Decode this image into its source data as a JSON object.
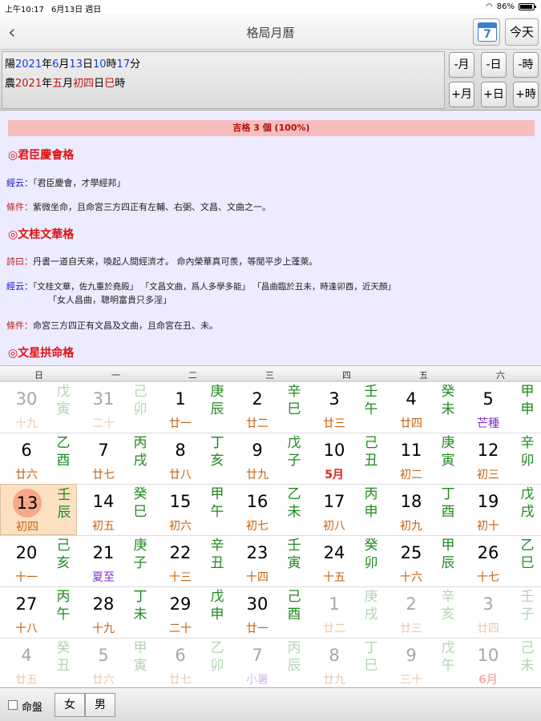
{
  "status": {
    "time": "上午10:17",
    "date": "6月13日 週日",
    "battery": "86%"
  },
  "nav": {
    "title": "格局月曆",
    "calendar_day": "7",
    "today_label": "今天"
  },
  "info": {
    "solar": [
      "陽",
      "2021",
      "年",
      "6",
      "月",
      "13",
      "日",
      "10",
      "時",
      "17",
      "分"
    ],
    "lunar": [
      "農",
      "2021",
      "年",
      "五",
      "月",
      "初四",
      "日",
      "巳",
      "時"
    ],
    "buttons": {
      "minus_month": "-月",
      "minus_day": "-日",
      "minus_hour": "-時",
      "plus_month": "+月",
      "plus_day": "+日",
      "plus_hour": "+時"
    }
  },
  "content": {
    "banner": "吉格 3 個 (100%)",
    "sections": [
      {
        "title": "◎君臣慶會格",
        "rows": [
          {
            "label": "經云：",
            "text": "「君臣慶會，才學經邦」"
          },
          {
            "label": "條件：",
            "text": "紫微坐命，且命宮三方四正有左輔、右弼、文昌、文曲之一。"
          }
        ]
      },
      {
        "title": "◎文桂文華格",
        "rows": [
          {
            "label": "詩曰：",
            "text": "丹書一道自天來，喚起人間經濟才。 命內榮華真可羨，等閒平步上蓬萊。"
          },
          {
            "label": "經云：",
            "text": "「文桂文華，佐九重於堯殿」 「文昌文曲，爲人多學多能」 「昌曲臨於丑未，時逢卯酉，近天顏」",
            "text2": "「女人昌曲，聰明富貴只多淫」"
          },
          {
            "label": "條件：",
            "text": "命宮三方四正有文昌及文曲，且命宮在丑、未。"
          }
        ]
      },
      {
        "title": "◎文星拱命格",
        "rows": []
      }
    ]
  },
  "calendar": {
    "weekdays": [
      "日",
      "一",
      "二",
      "三",
      "四",
      "五",
      "六"
    ],
    "rows": [
      [
        {
          "day": "30",
          "lunar": "十九",
          "gz": "戊寅",
          "dim": true
        },
        {
          "day": "31",
          "lunar": "二十",
          "gz": "己卯",
          "dim": true
        },
        {
          "day": "1",
          "lunar": "廿一",
          "gz": "庚辰"
        },
        {
          "day": "2",
          "lunar": "廿二",
          "gz": "辛巳"
        },
        {
          "day": "3",
          "lunar": "廿三",
          "gz": "壬午"
        },
        {
          "day": "4",
          "lunar": "廿四",
          "gz": "癸未"
        },
        {
          "day": "5",
          "lunar": "芒種",
          "gz": "甲申",
          "term": true
        }
      ],
      [
        {
          "day": "6",
          "lunar": "廿六",
          "gz": "乙酉"
        },
        {
          "day": "7",
          "lunar": "廿七",
          "gz": "丙戌"
        },
        {
          "day": "8",
          "lunar": "廿八",
          "gz": "丁亥"
        },
        {
          "day": "9",
          "lunar": "廿九",
          "gz": "戊子"
        },
        {
          "day": "10",
          "lunar": "5月",
          "gz": "己丑",
          "month": true
        },
        {
          "day": "11",
          "lunar": "初二",
          "gz": "庚寅"
        },
        {
          "day": "12",
          "lunar": "初三",
          "gz": "辛卯"
        }
      ],
      [
        {
          "day": "13",
          "lunar": "初四",
          "gz": "壬辰",
          "today": true
        },
        {
          "day": "14",
          "lunar": "初五",
          "gz": "癸巳"
        },
        {
          "day": "15",
          "lunar": "初六",
          "gz": "甲午"
        },
        {
          "day": "16",
          "lunar": "初七",
          "gz": "乙未"
        },
        {
          "day": "17",
          "lunar": "初八",
          "gz": "丙申"
        },
        {
          "day": "18",
          "lunar": "初九",
          "gz": "丁酉"
        },
        {
          "day": "19",
          "lunar": "初十",
          "gz": "戊戌"
        }
      ],
      [
        {
          "day": "20",
          "lunar": "十一",
          "gz": "己亥"
        },
        {
          "day": "21",
          "lunar": "夏至",
          "gz": "庚子",
          "term": true
        },
        {
          "day": "22",
          "lunar": "十三",
          "gz": "辛丑"
        },
        {
          "day": "23",
          "lunar": "十四",
          "gz": "壬寅"
        },
        {
          "day": "24",
          "lunar": "十五",
          "gz": "癸卯"
        },
        {
          "day": "25",
          "lunar": "十六",
          "gz": "甲辰"
        },
        {
          "day": "26",
          "lunar": "十七",
          "gz": "乙巳"
        }
      ],
      [
        {
          "day": "27",
          "lunar": "十八",
          "gz": "丙午"
        },
        {
          "day": "28",
          "lunar": "十九",
          "gz": "丁未"
        },
        {
          "day": "29",
          "lunar": "二十",
          "gz": "戊申"
        },
        {
          "day": "30",
          "lunar": "廿一",
          "gz": "己酉"
        },
        {
          "day": "1",
          "lunar": "廿二",
          "gz": "庚戌",
          "dim": true
        },
        {
          "day": "2",
          "lunar": "廿三",
          "gz": "辛亥",
          "dim": true
        },
        {
          "day": "3",
          "lunar": "廿四",
          "gz": "壬子",
          "dim": true
        }
      ],
      [
        {
          "day": "4",
          "lunar": "廿五",
          "gz": "癸丑",
          "dim": true
        },
        {
          "day": "5",
          "lunar": "廿六",
          "gz": "甲寅",
          "dim": true
        },
        {
          "day": "6",
          "lunar": "廿七",
          "gz": "乙卯",
          "dim": true
        },
        {
          "day": "7",
          "lunar": "小暑",
          "gz": "丙辰",
          "dim": true,
          "term": true
        },
        {
          "day": "8",
          "lunar": "廿九",
          "gz": "丁巳",
          "dim": true
        },
        {
          "day": "9",
          "lunar": "三十",
          "gz": "戊午",
          "dim": true
        },
        {
          "day": "10",
          "lunar": "6月",
          "gz": "己未",
          "dim": true,
          "month": true
        }
      ]
    ]
  },
  "bottom": {
    "checkbox_label": "命盤",
    "female": "女",
    "male": "男"
  },
  "colors": {
    "ganzhi": "#1f8a1f",
    "lunar": "#c8600c",
    "term": "#8a2ad0",
    "month_start": "#e02020",
    "title_red": "#e01010",
    "label_blue": "#1010d0"
  }
}
